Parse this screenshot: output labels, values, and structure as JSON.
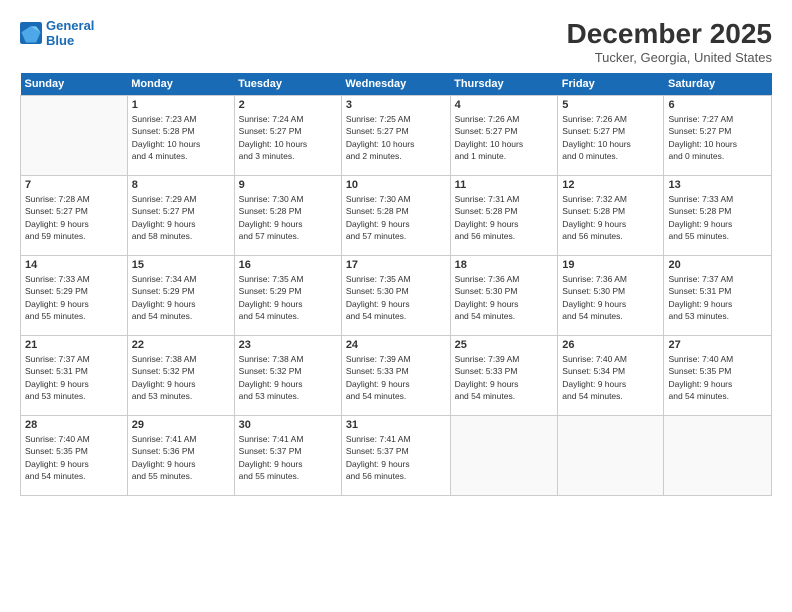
{
  "logo": {
    "line1": "General",
    "line2": "Blue"
  },
  "title": "December 2025",
  "subtitle": "Tucker, Georgia, United States",
  "header_color": "#1a6bb5",
  "days_of_week": [
    "Sunday",
    "Monday",
    "Tuesday",
    "Wednesday",
    "Thursday",
    "Friday",
    "Saturday"
  ],
  "weeks": [
    [
      {
        "num": "",
        "info": ""
      },
      {
        "num": "1",
        "info": "Sunrise: 7:23 AM\nSunset: 5:28 PM\nDaylight: 10 hours\nand 4 minutes."
      },
      {
        "num": "2",
        "info": "Sunrise: 7:24 AM\nSunset: 5:27 PM\nDaylight: 10 hours\nand 3 minutes."
      },
      {
        "num": "3",
        "info": "Sunrise: 7:25 AM\nSunset: 5:27 PM\nDaylight: 10 hours\nand 2 minutes."
      },
      {
        "num": "4",
        "info": "Sunrise: 7:26 AM\nSunset: 5:27 PM\nDaylight: 10 hours\nand 1 minute."
      },
      {
        "num": "5",
        "info": "Sunrise: 7:26 AM\nSunset: 5:27 PM\nDaylight: 10 hours\nand 0 minutes."
      },
      {
        "num": "6",
        "info": "Sunrise: 7:27 AM\nSunset: 5:27 PM\nDaylight: 10 hours\nand 0 minutes."
      }
    ],
    [
      {
        "num": "7",
        "info": "Sunrise: 7:28 AM\nSunset: 5:27 PM\nDaylight: 9 hours\nand 59 minutes."
      },
      {
        "num": "8",
        "info": "Sunrise: 7:29 AM\nSunset: 5:27 PM\nDaylight: 9 hours\nand 58 minutes."
      },
      {
        "num": "9",
        "info": "Sunrise: 7:30 AM\nSunset: 5:28 PM\nDaylight: 9 hours\nand 57 minutes."
      },
      {
        "num": "10",
        "info": "Sunrise: 7:30 AM\nSunset: 5:28 PM\nDaylight: 9 hours\nand 57 minutes."
      },
      {
        "num": "11",
        "info": "Sunrise: 7:31 AM\nSunset: 5:28 PM\nDaylight: 9 hours\nand 56 minutes."
      },
      {
        "num": "12",
        "info": "Sunrise: 7:32 AM\nSunset: 5:28 PM\nDaylight: 9 hours\nand 56 minutes."
      },
      {
        "num": "13",
        "info": "Sunrise: 7:33 AM\nSunset: 5:28 PM\nDaylight: 9 hours\nand 55 minutes."
      }
    ],
    [
      {
        "num": "14",
        "info": "Sunrise: 7:33 AM\nSunset: 5:29 PM\nDaylight: 9 hours\nand 55 minutes."
      },
      {
        "num": "15",
        "info": "Sunrise: 7:34 AM\nSunset: 5:29 PM\nDaylight: 9 hours\nand 54 minutes."
      },
      {
        "num": "16",
        "info": "Sunrise: 7:35 AM\nSunset: 5:29 PM\nDaylight: 9 hours\nand 54 minutes."
      },
      {
        "num": "17",
        "info": "Sunrise: 7:35 AM\nSunset: 5:30 PM\nDaylight: 9 hours\nand 54 minutes."
      },
      {
        "num": "18",
        "info": "Sunrise: 7:36 AM\nSunset: 5:30 PM\nDaylight: 9 hours\nand 54 minutes."
      },
      {
        "num": "19",
        "info": "Sunrise: 7:36 AM\nSunset: 5:30 PM\nDaylight: 9 hours\nand 54 minutes."
      },
      {
        "num": "20",
        "info": "Sunrise: 7:37 AM\nSunset: 5:31 PM\nDaylight: 9 hours\nand 53 minutes."
      }
    ],
    [
      {
        "num": "21",
        "info": "Sunrise: 7:37 AM\nSunset: 5:31 PM\nDaylight: 9 hours\nand 53 minutes."
      },
      {
        "num": "22",
        "info": "Sunrise: 7:38 AM\nSunset: 5:32 PM\nDaylight: 9 hours\nand 53 minutes."
      },
      {
        "num": "23",
        "info": "Sunrise: 7:38 AM\nSunset: 5:32 PM\nDaylight: 9 hours\nand 53 minutes."
      },
      {
        "num": "24",
        "info": "Sunrise: 7:39 AM\nSunset: 5:33 PM\nDaylight: 9 hours\nand 54 minutes."
      },
      {
        "num": "25",
        "info": "Sunrise: 7:39 AM\nSunset: 5:33 PM\nDaylight: 9 hours\nand 54 minutes."
      },
      {
        "num": "26",
        "info": "Sunrise: 7:40 AM\nSunset: 5:34 PM\nDaylight: 9 hours\nand 54 minutes."
      },
      {
        "num": "27",
        "info": "Sunrise: 7:40 AM\nSunset: 5:35 PM\nDaylight: 9 hours\nand 54 minutes."
      }
    ],
    [
      {
        "num": "28",
        "info": "Sunrise: 7:40 AM\nSunset: 5:35 PM\nDaylight: 9 hours\nand 54 minutes."
      },
      {
        "num": "29",
        "info": "Sunrise: 7:41 AM\nSunset: 5:36 PM\nDaylight: 9 hours\nand 55 minutes."
      },
      {
        "num": "30",
        "info": "Sunrise: 7:41 AM\nSunset: 5:37 PM\nDaylight: 9 hours\nand 55 minutes."
      },
      {
        "num": "31",
        "info": "Sunrise: 7:41 AM\nSunset: 5:37 PM\nDaylight: 9 hours\nand 56 minutes."
      },
      {
        "num": "",
        "info": ""
      },
      {
        "num": "",
        "info": ""
      },
      {
        "num": "",
        "info": ""
      }
    ]
  ]
}
